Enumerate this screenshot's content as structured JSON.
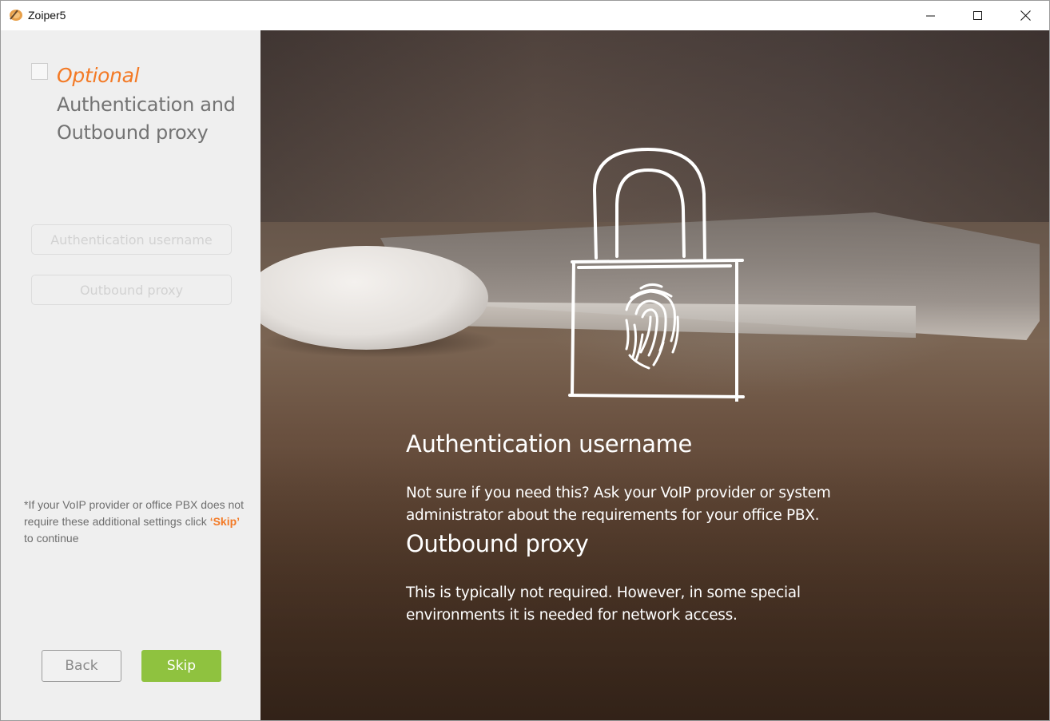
{
  "window": {
    "title": "Zoiper5",
    "icon": "zoiper-logo-icon",
    "controls": [
      "minimize-icon",
      "maximize-icon",
      "close-icon"
    ]
  },
  "sidebar": {
    "step_optional_label": "Optional",
    "step_title": "Authentication and Outbound proxy",
    "fields": {
      "auth_username_placeholder": "Authentication username",
      "outbound_proxy_placeholder": "Outbound proxy"
    },
    "note": {
      "prefix": "*If your VoIP provider or office PBX does not require these additional settings click ",
      "skip_word": "‘Skip’",
      "suffix": " to continue"
    },
    "buttons": {
      "back": "Back",
      "skip": "Skip"
    }
  },
  "info": {
    "sections": [
      {
        "title": "Authentication username",
        "text": "Not sure if you need this? Ask your VoIP provider or system administrator about the requirements for your office PBX."
      },
      {
        "title": "Outbound proxy",
        "text": "This is typically not required. However, in some special environments it is needed for network access."
      }
    ]
  },
  "colors": {
    "accent_orange": "#f37a26",
    "skip_green": "#8fc23f",
    "sidebar_bg": "#efefef"
  }
}
